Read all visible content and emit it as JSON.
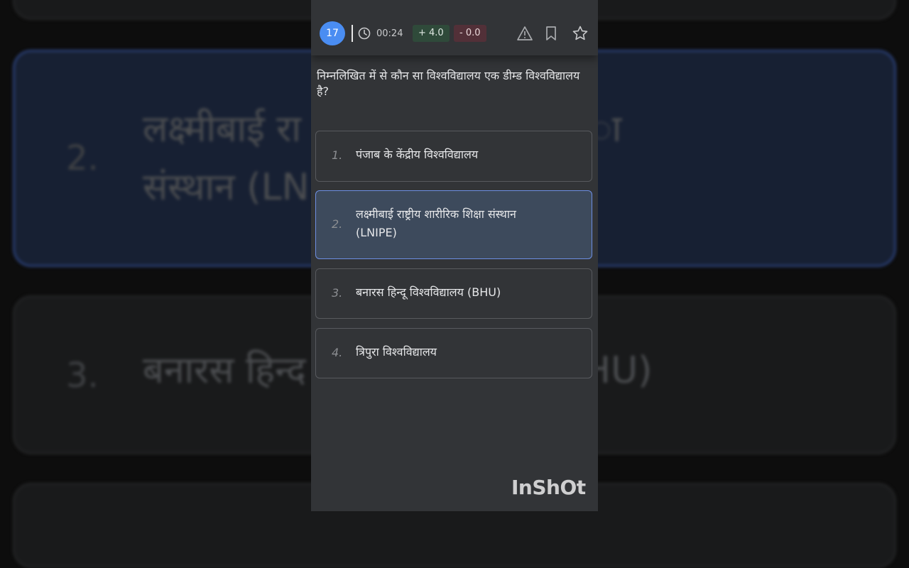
{
  "background": {
    "items": [
      {
        "number": "2.",
        "line1": "लक्ष्मीबाई रा",
        "line1_right": "ा",
        "line2": "संस्थान (LN"
      },
      {
        "number": "3.",
        "line1": "बनारस हिन्द",
        "line1_right": "HU)"
      }
    ]
  },
  "header": {
    "question_number": "17",
    "timer": "00:24",
    "positive_marks": "+ 4.0",
    "negative_marks": "- 0.0",
    "icons": [
      "clock-icon",
      "report-warning-icon",
      "bookmark-icon",
      "star-icon"
    ]
  },
  "question": {
    "text": "निम्नलिखित में से कौन सा विश्वविद्यालय एक डीम्ड विश्वविद्यालय है?"
  },
  "options": [
    {
      "number": "1.",
      "text": "पंजाब के केंद्रीय विश्वविद्यालय",
      "selected": false
    },
    {
      "number": "2.",
      "text": "लक्ष्मीबाई राष्ट्रीय शारीरिक शिक्षा संस्थान (LNIPE)",
      "selected": true
    },
    {
      "number": "3.",
      "text": "बनारस हिन्दू विश्वविद्यालय (BHU)",
      "selected": false
    },
    {
      "number": "4.",
      "text": "त्रिपुरा विश्वविद्यालय",
      "selected": false
    }
  ],
  "watermark": "InShOt",
  "colors": {
    "accent": "#4a8df2",
    "selected_border": "#6d8fe3",
    "positive_bg": "#2f4a3a",
    "negative_bg": "#523038"
  }
}
